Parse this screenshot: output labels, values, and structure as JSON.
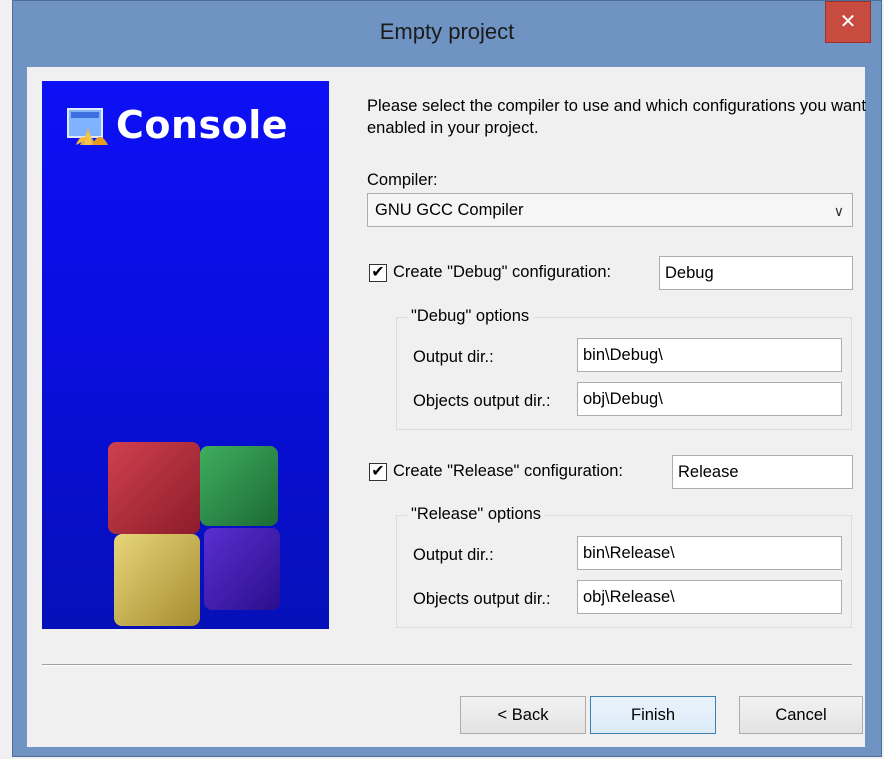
{
  "window": {
    "title": "Empty project",
    "close_label": "✕"
  },
  "banner": {
    "title": "Console"
  },
  "intro_text": "Please select the compiler to use and which configurations you want enabled in your project.",
  "compiler": {
    "label": "Compiler:",
    "selected": "GNU GCC Compiler"
  },
  "debug": {
    "checked": true,
    "check_label": "Create \"Debug\" configuration:",
    "name_value": "Debug",
    "group_title": "\"Debug\" options",
    "output_dir_label": "Output dir.:",
    "output_dir_value": "bin\\Debug\\",
    "objects_dir_label": "Objects output dir.:",
    "objects_dir_value": "obj\\Debug\\"
  },
  "release": {
    "checked": true,
    "check_label": "Create \"Release\" configuration:",
    "name_value": "Release",
    "group_title": "\"Release\" options",
    "output_dir_label": "Output dir.:",
    "output_dir_value": "bin\\Release\\",
    "objects_dir_label": "Objects output dir.:",
    "objects_dir_value": "obj\\Release\\"
  },
  "buttons": {
    "back": "< Back",
    "finish": "Finish",
    "cancel": "Cancel"
  },
  "icons": {
    "check": "✔",
    "dropdown": "chevron-down-icon",
    "close": "close-icon"
  },
  "colors": {
    "banner": "#0d10f5",
    "titlebar": "#6f94c3",
    "close": "#c74b3f"
  }
}
